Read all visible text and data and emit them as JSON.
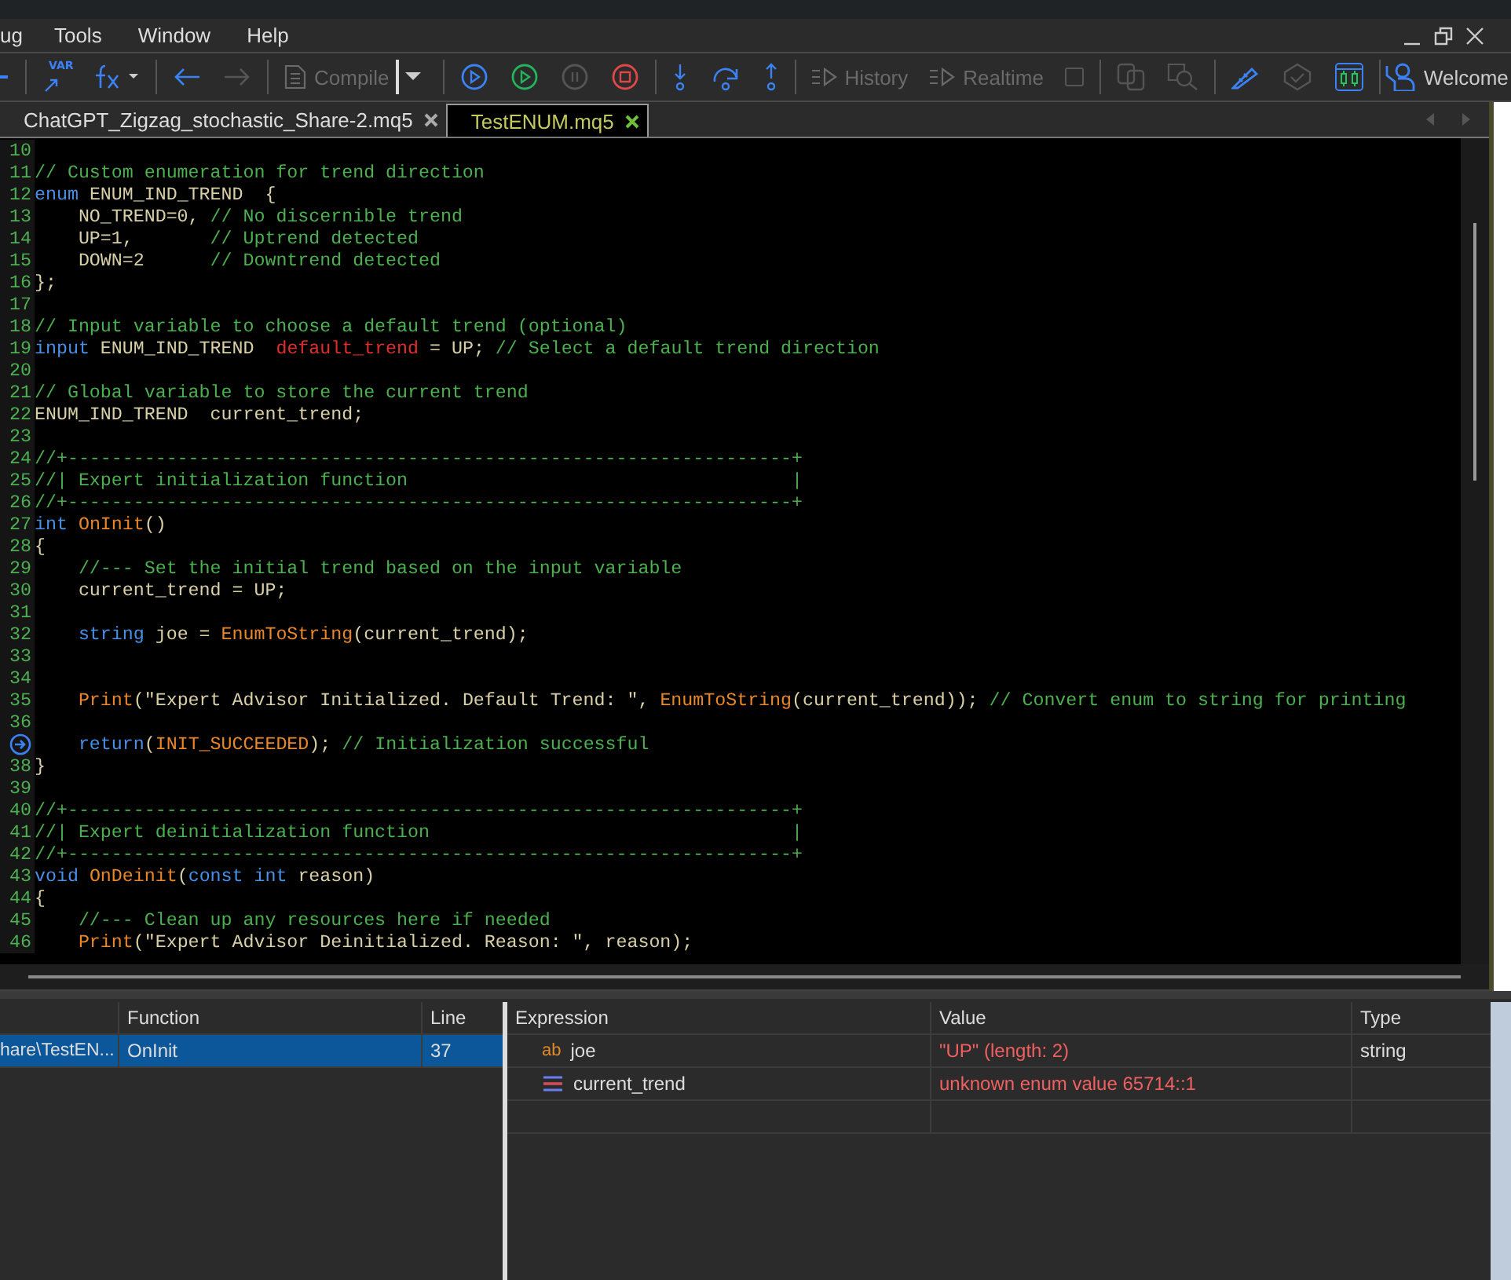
{
  "menu": [
    "ug",
    "Tools",
    "Window",
    "Help"
  ],
  "toolbar": {
    "variables": {
      "label": "VAR"
    },
    "compile": {
      "label": "Compile",
      "disabled": true
    },
    "history": {
      "label": "History",
      "disabled": true
    },
    "realtime": {
      "label": "Realtime",
      "disabled": true
    },
    "welcome": {
      "label": "Welcome"
    }
  },
  "tabs": [
    {
      "label": "ChatGPT_Zigzag_stochastic_Share-2.mq5",
      "selected": false
    },
    {
      "label": "TestENUM.mq5",
      "selected": true
    }
  ],
  "editor": {
    "lines": [
      {
        "number": "10",
        "current": false
      },
      {
        "number": "11",
        "current": false,
        "tokens": [
          {
            "kind": "c",
            "text": "// Custom enumeration for trend direction"
          }
        ]
      },
      {
        "number": "12",
        "current": false,
        "tokens": [
          {
            "kind": "k",
            "text": "enum"
          },
          {
            "kind": "t",
            "text": " ENUM_IND_TREND  {"
          }
        ]
      },
      {
        "number": "13",
        "current": false,
        "tokens": [
          {
            "kind": "t",
            "text": "    NO_TREND=0, "
          },
          {
            "kind": "c",
            "text": "// No discernible trend"
          }
        ]
      },
      {
        "number": "14",
        "current": false,
        "tokens": [
          {
            "kind": "t",
            "text": "    UP=1,       "
          },
          {
            "kind": "c",
            "text": "// Uptrend detected"
          }
        ]
      },
      {
        "number": "15",
        "current": false,
        "tokens": [
          {
            "kind": "t",
            "text": "    DOWN=2      "
          },
          {
            "kind": "c",
            "text": "// Downtrend detected"
          }
        ]
      },
      {
        "number": "16",
        "current": false,
        "tokens": [
          {
            "kind": "t",
            "text": "};"
          }
        ]
      },
      {
        "number": "17",
        "current": false
      },
      {
        "number": "18",
        "current": false,
        "tokens": [
          {
            "kind": "c",
            "text": "// Input variable to choose a default trend (optional)"
          }
        ]
      },
      {
        "number": "19",
        "current": false,
        "tokens": [
          {
            "kind": "k",
            "text": "input"
          },
          {
            "kind": "t",
            "text": " ENUM_IND_TREND  "
          },
          {
            "kind": "r",
            "text": "default_trend"
          },
          {
            "kind": "t",
            "text": " = UP; "
          },
          {
            "kind": "c",
            "text": "// Select a default trend direction"
          }
        ]
      },
      {
        "number": "20",
        "current": false
      },
      {
        "number": "21",
        "current": false,
        "tokens": [
          {
            "kind": "c",
            "text": "// Global variable to store the current trend"
          }
        ]
      },
      {
        "number": "22",
        "current": false,
        "tokens": [
          {
            "kind": "t",
            "text": "ENUM_IND_TREND  current_trend;"
          }
        ]
      },
      {
        "number": "23",
        "current": false
      },
      {
        "number": "24",
        "current": false,
        "tokens": [
          {
            "kind": "c",
            "text": "//+------------------------------------------------------------------+"
          }
        ]
      },
      {
        "number": "25",
        "current": false,
        "tokens": [
          {
            "kind": "c",
            "text": "//| Expert initialization function                                   |"
          }
        ]
      },
      {
        "number": "26",
        "current": false,
        "tokens": [
          {
            "kind": "c",
            "text": "//+------------------------------------------------------------------+"
          }
        ]
      },
      {
        "number": "27",
        "current": false,
        "tokens": [
          {
            "kind": "k",
            "text": "int"
          },
          {
            "kind": "f",
            "text": " OnInit"
          },
          {
            "kind": "t",
            "text": "()"
          }
        ]
      },
      {
        "number": "28",
        "current": false,
        "tokens": [
          {
            "kind": "t",
            "text": "{"
          }
        ]
      },
      {
        "number": "29",
        "current": false,
        "tokens": [
          {
            "kind": "c",
            "text": "    //--- Set the initial trend based on the input variable"
          }
        ]
      },
      {
        "number": "30",
        "current": false,
        "tokens": [
          {
            "kind": "t",
            "text": "    current_trend = UP;"
          }
        ]
      },
      {
        "number": "31",
        "current": false
      },
      {
        "number": "32",
        "current": false,
        "tokens": [
          {
            "kind": "k",
            "text": "    string"
          },
          {
            "kind": "t",
            "text": " joe = "
          },
          {
            "kind": "f",
            "text": "EnumToString"
          },
          {
            "kind": "t",
            "text": "(current_trend);"
          }
        ]
      },
      {
        "number": "33",
        "current": false
      },
      {
        "number": "34",
        "current": false
      },
      {
        "number": "35",
        "current": false,
        "tokens": [
          {
            "kind": "f",
            "text": "    Print"
          },
          {
            "kind": "t",
            "text": "(\"Expert Advisor Initialized. Default Trend: \", "
          },
          {
            "kind": "f",
            "text": "EnumToString"
          },
          {
            "kind": "t",
            "text": "(current_trend)); "
          },
          {
            "kind": "c",
            "text": "// Convert enum to string for printing"
          }
        ]
      },
      {
        "number": "36",
        "current": false
      },
      {
        "current": true,
        "tokens": [
          {
            "kind": "k",
            "text": "    return"
          },
          {
            "kind": "t",
            "text": "("
          },
          {
            "kind": "f",
            "text": "INIT_SUCCEEDED"
          },
          {
            "kind": "t",
            "text": "); "
          },
          {
            "kind": "c",
            "text": "// Initialization successful"
          }
        ]
      },
      {
        "number": "38",
        "current": false,
        "tokens": [
          {
            "kind": "t",
            "text": "}"
          }
        ]
      },
      {
        "number": "39",
        "current": false
      },
      {
        "number": "40",
        "current": false,
        "tokens": [
          {
            "kind": "c",
            "text": "//+------------------------------------------------------------------+"
          }
        ]
      },
      {
        "number": "41",
        "current": false,
        "tokens": [
          {
            "kind": "c",
            "text": "//| Expert deinitialization function                                 |"
          }
        ]
      },
      {
        "number": "42",
        "current": false,
        "tokens": [
          {
            "kind": "c",
            "text": "//+------------------------------------------------------------------+"
          }
        ]
      },
      {
        "number": "43",
        "current": false,
        "tokens": [
          {
            "kind": "k",
            "text": "void"
          },
          {
            "kind": "f",
            "text": " OnDeinit"
          },
          {
            "kind": "t",
            "text": "("
          },
          {
            "kind": "k",
            "text": "const int"
          },
          {
            "kind": "t",
            "text": " reason)"
          }
        ]
      },
      {
        "number": "44",
        "current": false,
        "tokens": [
          {
            "kind": "t",
            "text": "{"
          }
        ]
      },
      {
        "number": "45",
        "current": false,
        "tokens": [
          {
            "kind": "c",
            "text": "    //--- Clean up any resources here if needed"
          }
        ]
      },
      {
        "number": "46",
        "current": false,
        "tokens": [
          {
            "kind": "f",
            "text": "    Print"
          },
          {
            "kind": "t",
            "text": "(\"Expert Advisor Deinitialized. Reason: \", reason);"
          }
        ]
      }
    ]
  },
  "call_stack": {
    "columns": [
      "Function",
      "Line"
    ],
    "rows": [
      {
        "column_1": "hare\\TestEN...",
        "function": "OnInit",
        "line": "37",
        "selected": true
      }
    ]
  },
  "watch": {
    "columns": [
      "Expression",
      "Value",
      "Type"
    ],
    "rows": [
      {
        "kind": "string",
        "badge": "ab",
        "name": "joe",
        "value": "\"UP\" (length: 2)",
        "type": "string"
      },
      {
        "kind": "enum",
        "name": "current_trend",
        "value": "unknown enum value 65714::1"
      }
    ]
  }
}
